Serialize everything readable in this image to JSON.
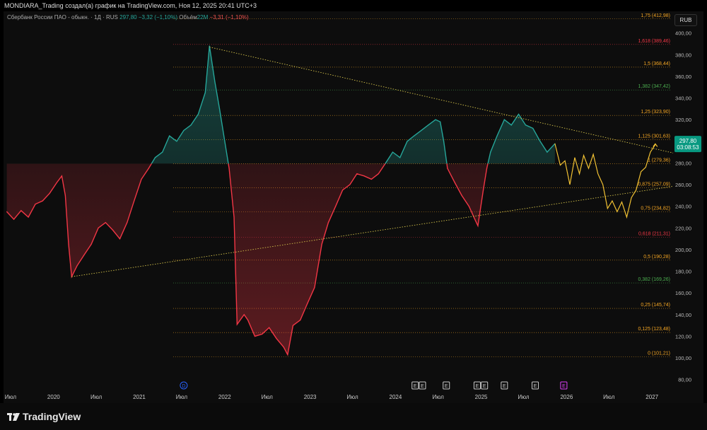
{
  "header": {
    "title": "MONDIARA_Trading создал(а) график на TradingView.com, Ноя 12, 2025 20:41 UTC+3"
  },
  "legend": {
    "symbol": "Сбербанк России ПАО - обыкн. · 1Д · RUS",
    "price": "297,80",
    "change": "−3,32 (−1,10%)",
    "volume_label": "Объём",
    "volume": "22M",
    "volume_change": "−3,31 (−1,10%)"
  },
  "currency_button": "RUB",
  "price_tag": {
    "price": "297,80",
    "timer": "03:08:53"
  },
  "footer": {
    "logo_text": "TradingView"
  },
  "colors": {
    "up": "#26a69a",
    "down": "#f23645",
    "projection": "#f2c233",
    "trendline": "#d4c24a",
    "fib_orange": "#f5a623",
    "fib_red": "#f23645",
    "fib_green": "#4caf50",
    "event_marker": "#e040fb",
    "dividend_marker": "#2962ff"
  },
  "chart_data": {
    "type": "line",
    "y_axis": {
      "ticks": [
        "400,00",
        "380,00",
        "360,00",
        "340,00",
        "320,00",
        "300,00",
        "280,00",
        "260,00",
        "240,00",
        "220,00",
        "200,00",
        "180,00",
        "160,00",
        "140,00",
        "120,00",
        "100,00",
        "80,00"
      ],
      "range": [
        72,
        420
      ]
    },
    "x_axis": {
      "labels": [
        "Июл",
        "2020",
        "Июл",
        "2021",
        "Июл",
        "2022",
        "Июл",
        "2023",
        "Июл",
        "2024",
        "Июл",
        "2025",
        "Июл",
        "2026",
        "Июл",
        "2027"
      ],
      "dates": [
        "2019-07",
        "2020-01",
        "2020-07",
        "2021-01",
        "2021-07",
        "2022-01",
        "2022-07",
        "2023-01",
        "2023-07",
        "2024-01",
        "2024-07",
        "2025-01",
        "2025-07",
        "2026-01",
        "2026-07",
        "2027-01"
      ]
    },
    "fib_levels": [
      {
        "ratio": "1,75",
        "value": 412.98,
        "label": "1,75 (412,98)",
        "color": "orange"
      },
      {
        "ratio": "1,618",
        "value": 389.46,
        "label": "1,618 (389,46)",
        "color": "red"
      },
      {
        "ratio": "1,5",
        "value": 368.44,
        "label": "1,5 (368,44)",
        "color": "orange"
      },
      {
        "ratio": "1,382",
        "value": 347.42,
        "label": "1,382 (347,42)",
        "color": "green"
      },
      {
        "ratio": "1,25",
        "value": 323.9,
        "label": "1,25 (323,90)",
        "color": "orange"
      },
      {
        "ratio": "1,125",
        "value": 301.63,
        "label": "1,125 (301,63)",
        "color": "orange"
      },
      {
        "ratio": "1",
        "value": 279.36,
        "label": "1 (279,36)",
        "color": "orange"
      },
      {
        "ratio": "0,875",
        "value": 257.09,
        "label": "0,875 (257,09)",
        "color": "orange"
      },
      {
        "ratio": "0,75",
        "value": 234.82,
        "label": "0,75 (234,82)",
        "color": "orange"
      },
      {
        "ratio": "0,618",
        "value": 211.31,
        "label": "0,618 (211,31)",
        "color": "red"
      },
      {
        "ratio": "0,5",
        "value": 190.28,
        "label": "0,5 (190,28)",
        "color": "orange"
      },
      {
        "ratio": "0,382",
        "value": 169.26,
        "label": "0,382 (169,26)",
        "color": "green"
      },
      {
        "ratio": "0,25",
        "value": 145.74,
        "label": "0,25 (145,74)",
        "color": "orange"
      },
      {
        "ratio": "0,125",
        "value": 123.48,
        "label": "0,125 (123,48)",
        "color": "orange"
      },
      {
        "ratio": "0",
        "value": 101.21,
        "label": "0 (101,21)",
        "color": "orange"
      }
    ],
    "baseline": 279.36,
    "series": [
      {
        "x": [
          "2019-06-15",
          "2019-07-15",
          "2019-08-15",
          "2019-09-15",
          "2019-10-15",
          "2019-11-15",
          "2019-12-15",
          "2020-01-15",
          "2020-02-05",
          "2020-02-20",
          "2020-03-05",
          "2020-03-18",
          "2020-04-10",
          "2020-05-10",
          "2020-06-10",
          "2020-07-10",
          "2020-08-10",
          "2020-09-10",
          "2020-10-10",
          "2020-11-10",
          "2020-12-10",
          "2021-01-10",
          "2021-02-10",
          "2021-03-10",
          "2021-04-10",
          "2021-05-10",
          "2021-06-10",
          "2021-07-10",
          "2021-08-10",
          "2021-09-10",
          "2021-10-10",
          "2021-10-28",
          "2021-11-20",
          "2021-12-10",
          "2022-01-05",
          "2022-01-20",
          "2022-02-10",
          "2022-02-23",
          "2022-03-25",
          "2022-04-10",
          "2022-05-10",
          "2022-06-10",
          "2022-07-10",
          "2022-08-10",
          "2022-09-10",
          "2022-09-27",
          "2022-10-20",
          "2022-11-20",
          "2022-12-20",
          "2023-01-20",
          "2023-02-20",
          "2023-03-20",
          "2023-04-20",
          "2023-05-20",
          "2023-06-20",
          "2023-07-20",
          "2023-08-20",
          "2023-09-20",
          "2023-10-20",
          "2023-11-20",
          "2023-12-20",
          "2024-01-20",
          "2024-02-20",
          "2024-03-20",
          "2024-04-20",
          "2024-05-20",
          "2024-06-20",
          "2024-07-10",
          "2024-07-25",
          "2024-08-10",
          "2024-09-10",
          "2024-10-10",
          "2024-11-10",
          "2024-12-05",
          "2024-12-18",
          "2025-01-10",
          "2025-01-25",
          "2025-02-10",
          "2025-03-10",
          "2025-04-10",
          "2025-05-10",
          "2025-06-10",
          "2025-07-10",
          "2025-08-10",
          "2025-09-10",
          "2025-10-10",
          "2025-11-12"
        ],
        "values": [
          235,
          228,
          236,
          230,
          242,
          245,
          252,
          262,
          268,
          250,
          205,
          175,
          185,
          195,
          205,
          220,
          225,
          218,
          210,
          225,
          245,
          265,
          275,
          285,
          290,
          305,
          300,
          310,
          315,
          325,
          345,
          388,
          355,
          330,
          295,
          275,
          230,
          131,
          140,
          135,
          120,
          122,
          128,
          118,
          110,
          103,
          130,
          135,
          150,
          165,
          205,
          225,
          240,
          255,
          260,
          270,
          268,
          265,
          270,
          280,
          290,
          285,
          300,
          305,
          310,
          315,
          320,
          318,
          300,
          275,
          262,
          250,
          240,
          228,
          222,
          255,
          275,
          290,
          305,
          320,
          315,
          325,
          315,
          312,
          300,
          290,
          297.8
        ]
      }
    ],
    "projection": {
      "x": [
        "2025-11-12",
        "2025-12-05",
        "2025-12-25",
        "2026-01-15",
        "2026-02-05",
        "2026-02-25",
        "2026-03-15",
        "2026-04-05",
        "2026-04-25",
        "2026-05-15",
        "2026-06-05",
        "2026-06-25",
        "2026-07-15",
        "2026-08-05",
        "2026-08-25",
        "2026-09-15",
        "2026-10-05",
        "2026-10-25",
        "2026-11-15",
        "2026-12-05",
        "2026-12-25",
        "2027-01-15"
      ],
      "values": [
        298,
        278,
        282,
        260,
        285,
        270,
        287,
        275,
        288,
        270,
        260,
        238,
        245,
        235,
        244,
        230,
        248,
        255,
        272,
        276,
        290,
        297
      ]
    },
    "trendlines": [
      {
        "from": {
          "x": "2021-10-28",
          "y": 387
        },
        "to": {
          "x": "2027-01-15",
          "y": 293
        }
      },
      {
        "from": {
          "x": "2020-03-18",
          "y": 175
        },
        "to": {
          "x": "2027-01-15",
          "y": 256
        }
      }
    ],
    "event_markers": [
      {
        "x": "2021-07-10",
        "label": "D",
        "kind": "dividend"
      },
      {
        "x": "2024-03-25",
        "label": "E",
        "kind": "earnings"
      },
      {
        "x": "2024-04-25",
        "label": "E",
        "kind": "earnings"
      },
      {
        "x": "2024-08-05",
        "label": "E",
        "kind": "earnings"
      },
      {
        "x": "2024-12-15",
        "label": "E",
        "kind": "earnings"
      },
      {
        "x": "2025-01-15",
        "label": "E",
        "kind": "earnings"
      },
      {
        "x": "2025-04-10",
        "label": "E",
        "kind": "earnings"
      },
      {
        "x": "2025-08-20",
        "label": "E",
        "kind": "earnings"
      },
      {
        "x": "2025-12-20",
        "label": "E",
        "kind": "earnings-future"
      }
    ]
  }
}
